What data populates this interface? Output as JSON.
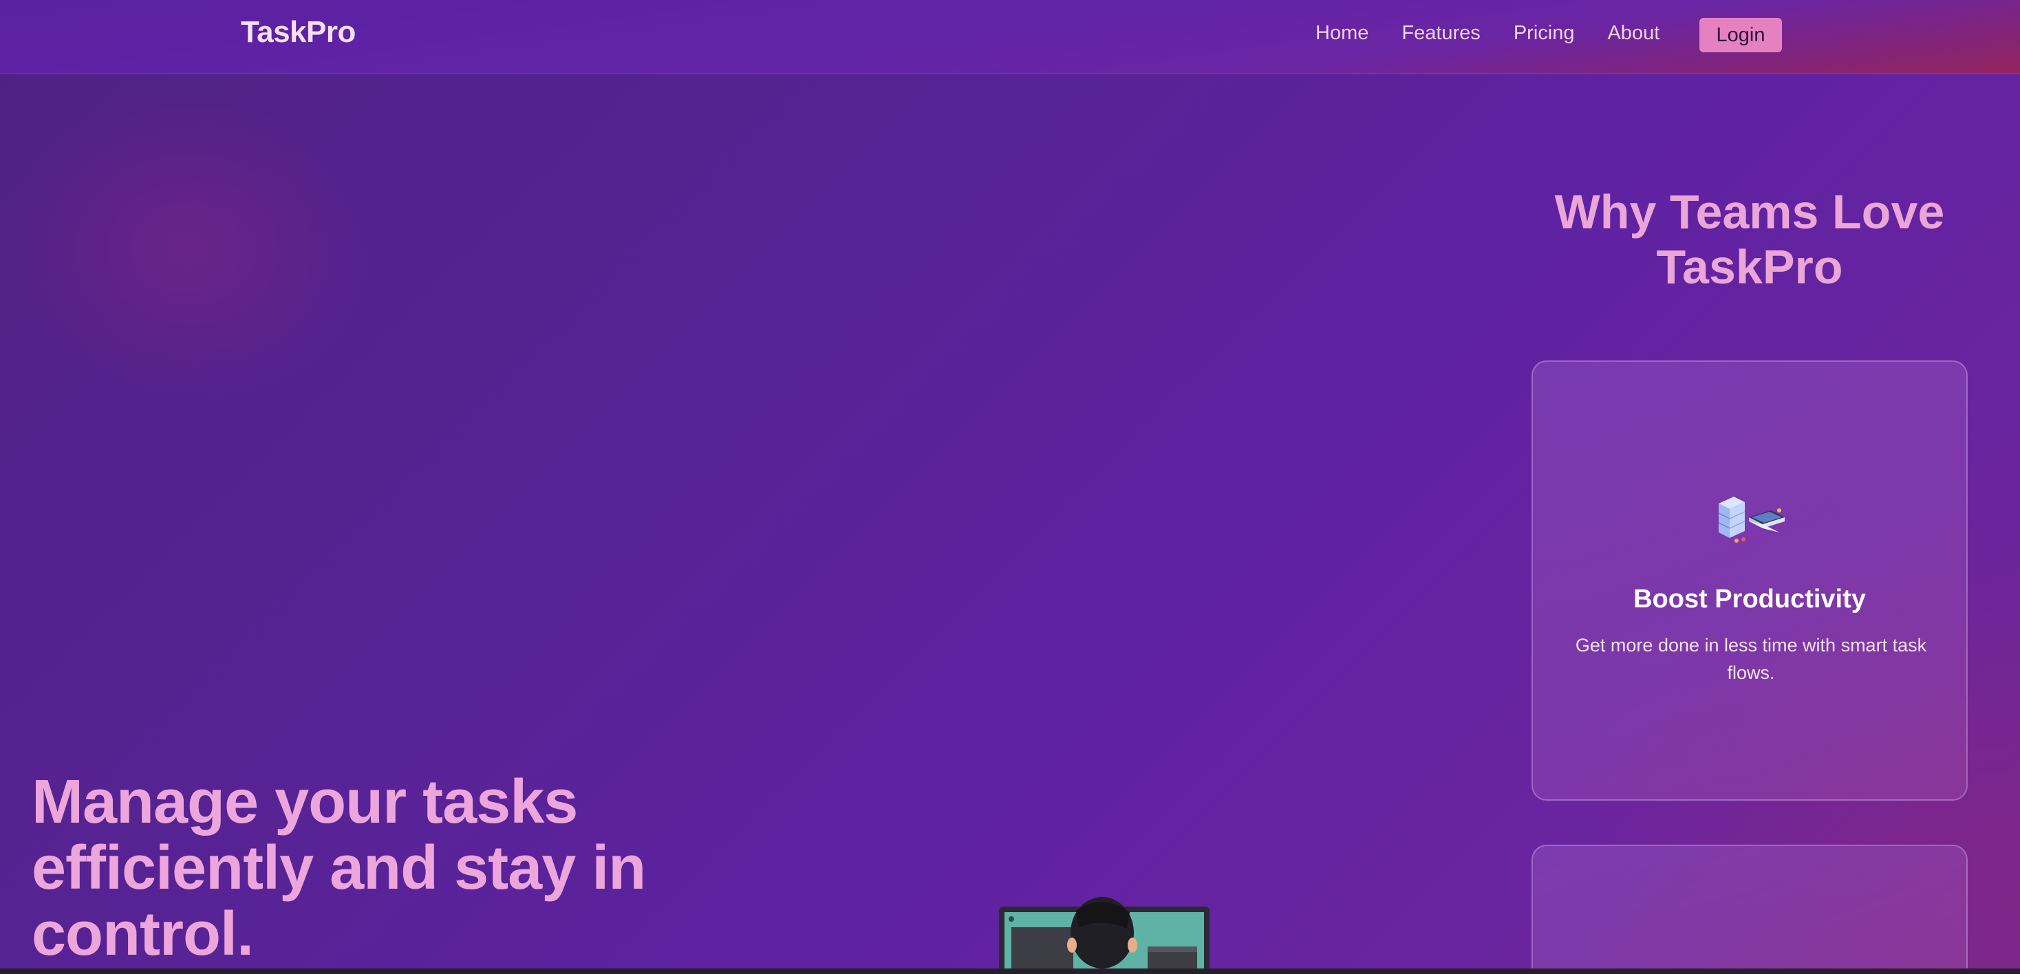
{
  "navbar": {
    "brand": "TaskPro",
    "links": [
      "Home",
      "Features",
      "Pricing",
      "About"
    ],
    "login_label": "Login"
  },
  "hero": {
    "title": "Manage your tasks efficiently and stay in control."
  },
  "why": {
    "title": "Why Teams Love TaskPro",
    "cards": [
      {
        "icon": "productivity-illustration-icon",
        "title": "Boost Productivity",
        "text": "Get more done in less time with smart task flows."
      }
    ]
  },
  "colors": {
    "accent_pink": "#e681c1",
    "heading_pink": "#eca6db",
    "background_purple": "#5a2298"
  }
}
